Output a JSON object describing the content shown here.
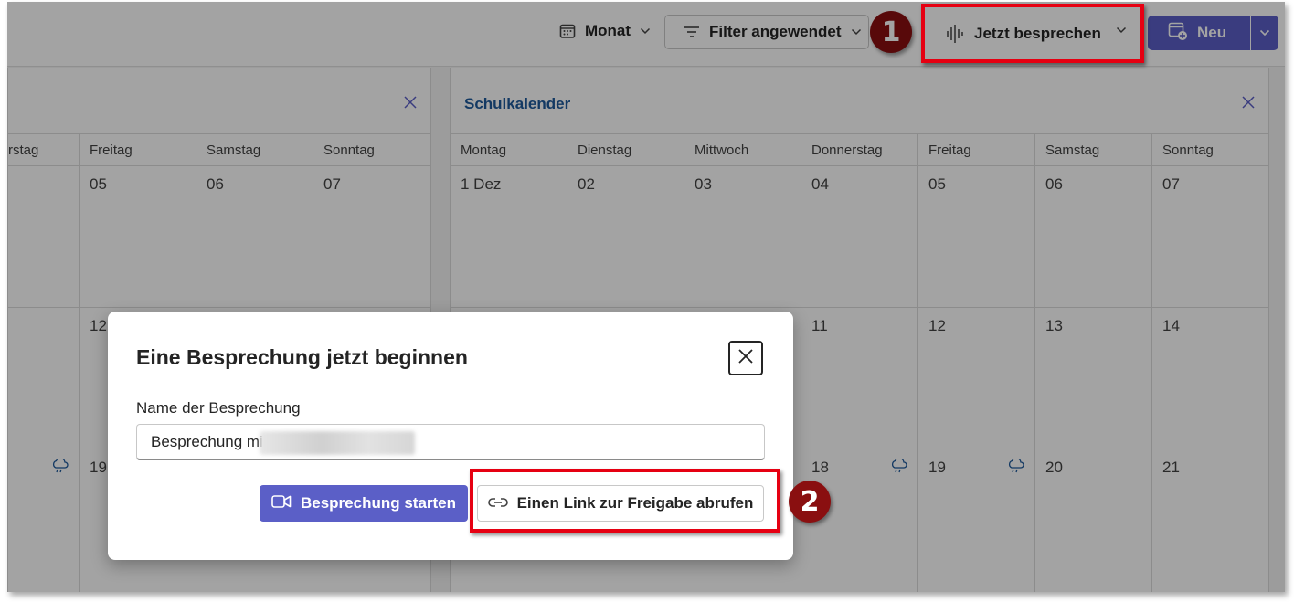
{
  "toolbar": {
    "month_label": "Monat",
    "filter_label": "Filter angewendet",
    "meet_now_label": "Jetzt besprechen",
    "new_label": "Neu"
  },
  "annotations": {
    "badge_1": "1",
    "badge_2": "2",
    "highlight_color": "#e60012",
    "badge_color": "#8a0f10"
  },
  "calendar_left": {
    "day_headers": [
      "rstag",
      "Freitag",
      "Samstag",
      "Sonntag"
    ],
    "rows": [
      [
        "",
        "05",
        "06",
        "07"
      ],
      [
        "",
        "12",
        "",
        ""
      ],
      [
        "",
        "19",
        "",
        ""
      ]
    ],
    "weather_icon": "cloud-rain-icon"
  },
  "calendar_right": {
    "title": "Schulkalender",
    "day_headers": [
      "Montag",
      "Dienstag",
      "Mittwoch",
      "Donnerstag",
      "Freitag",
      "Samstag",
      "Sonntag"
    ],
    "rows": [
      [
        "1 Dez",
        "02",
        "03",
        "04",
        "05",
        "06",
        "07"
      ],
      [
        "",
        "",
        "",
        "11",
        "12",
        "13",
        "14"
      ],
      [
        "",
        "",
        "",
        "18",
        "19",
        "20",
        "21"
      ]
    ]
  },
  "dialog": {
    "title": "Eine Besprechung jetzt beginnen",
    "name_label": "Name der Besprechung",
    "name_value": "Besprechung mi",
    "start_button": "Besprechung starten",
    "link_button": "Einen Link zur Freigabe abrufen"
  },
  "colors": {
    "accent": "#5b5fc7",
    "panel_title": "#1e5a9c"
  }
}
